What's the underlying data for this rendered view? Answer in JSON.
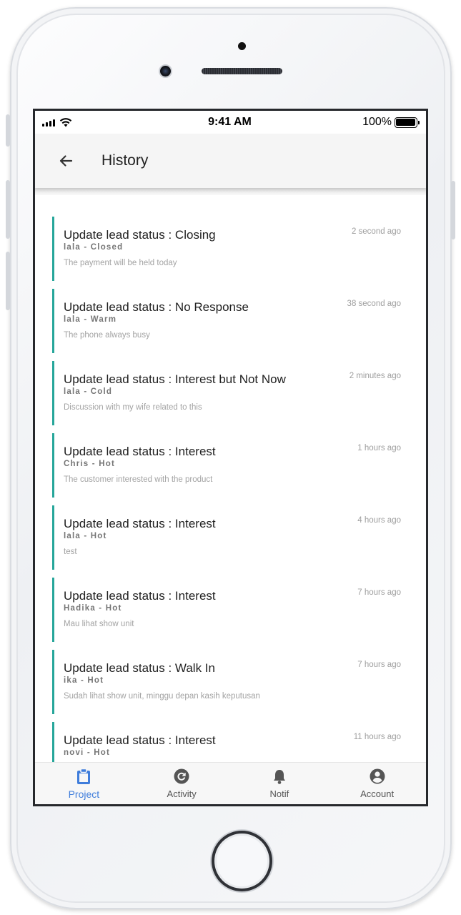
{
  "status_bar": {
    "time": "9:41 AM",
    "battery": "100%"
  },
  "header": {
    "title": "History",
    "back_icon": "arrow-left-icon"
  },
  "accent_color": "#26a69a",
  "history": [
    {
      "title": "Update lead status : Closing",
      "subtitle": "lala - Closed",
      "note": "The payment will be held today",
      "time": "2 second ago"
    },
    {
      "title": "Update lead status : No Response",
      "subtitle": "lala - Warm",
      "note": "The phone always busy",
      "time": "38 second ago"
    },
    {
      "title": "Update lead status : Interest but Not Now",
      "subtitle": "lala - Cold",
      "note": "Discussion with my wife related to this",
      "time": "2 minutes ago"
    },
    {
      "title": "Update lead status : Interest",
      "subtitle": "Chris - Hot",
      "note": "The customer interested with the product",
      "time": "1 hours ago"
    },
    {
      "title": "Update lead status : Interest",
      "subtitle": "lala - Hot",
      "note": "test",
      "time": "4 hours ago"
    },
    {
      "title": "Update lead status : Interest",
      "subtitle": "Hadika - Hot",
      "note": "Mau lihat show unit",
      "time": "7 hours ago"
    },
    {
      "title": "Update lead status : Walk In",
      "subtitle": "ika - Hot",
      "note": "Sudah lihat show unit, minggu depan kasih keputusan",
      "time": "7 hours ago"
    },
    {
      "title": "Update lead status : Interest",
      "subtitle": "novi - Hot",
      "note": "",
      "time": "11 hours ago"
    }
  ],
  "bottom_nav": [
    {
      "label": "Project",
      "icon": "clipboard-icon",
      "active": true,
      "color": "#3f7ddb"
    },
    {
      "label": "Activity",
      "icon": "refresh-icon",
      "active": false,
      "color": "#555555"
    },
    {
      "label": "Notif",
      "icon": "bell-icon",
      "active": false,
      "color": "#555555"
    },
    {
      "label": "Account",
      "icon": "account-icon",
      "active": false,
      "color": "#555555"
    }
  ]
}
